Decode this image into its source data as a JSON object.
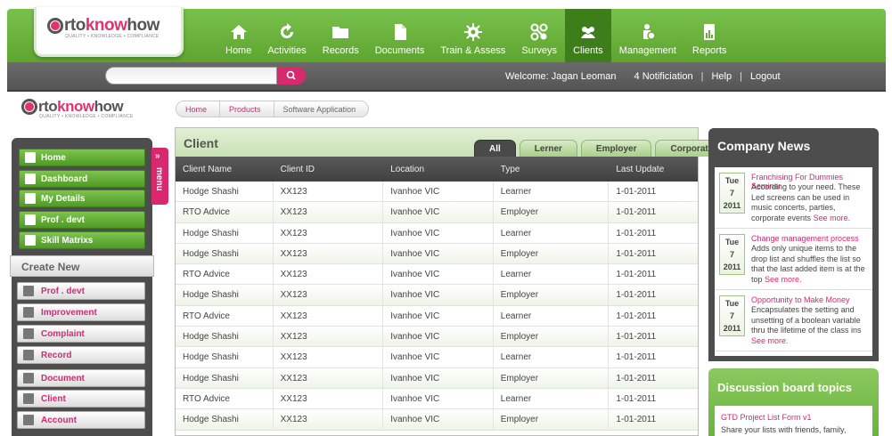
{
  "brand": {
    "part1": "rto",
    "part2": "know",
    "part3": "how",
    "tagline": "QUALITY • KNOWLEDGE • COMPLIANCE"
  },
  "nav": [
    {
      "label": "Home",
      "icon": "home-icon"
    },
    {
      "label": "Activities",
      "icon": "refresh-icon"
    },
    {
      "label": "Records",
      "icon": "folder-icon"
    },
    {
      "label": "Documents",
      "icon": "document-icon"
    },
    {
      "label": "Train & Assess",
      "icon": "gear-icon"
    },
    {
      "label": "Surveys",
      "icon": "survey-icon"
    },
    {
      "label": "Clients",
      "icon": "users-icon",
      "active": true
    },
    {
      "label": "Management",
      "icon": "management-icon"
    },
    {
      "label": "Reports",
      "icon": "reports-icon"
    }
  ],
  "search": {
    "placeholder": "",
    "value": ""
  },
  "topright": {
    "welcome": "Welcome: Jagan Leoman",
    "notifications": "4 Notificiation",
    "help": "Help",
    "logout": "Logout"
  },
  "sidebar": {
    "items": [
      "Home",
      "Dashboard",
      "My Details",
      "Prof . devt",
      "Skill Matrixs"
    ],
    "create_new": "Create New",
    "create_items": [
      "Prof . devt",
      "Improvement",
      "Complaint",
      "Record",
      "Document",
      "Client",
      "Account"
    ],
    "menu_tab": "menu"
  },
  "breadcrumb": [
    "Home",
    "Products",
    "Software Application"
  ],
  "client": {
    "title": "Client",
    "tabs": [
      "All",
      "Lerner",
      "Employer",
      "Corporate"
    ],
    "columns": [
      "Client Name",
      "Client ID",
      "Location",
      "Type",
      "Last Update"
    ],
    "rows": [
      [
        "Hodge Shashi",
        "XX123",
        "Ivanhoe VIC",
        "Learner",
        "1-01-2011"
      ],
      [
        "RTO Advice",
        "XX123",
        "Ivanhoe VIC",
        "Employer",
        "1-01-2011"
      ],
      [
        "Hodge Shashi",
        "XX123",
        "Ivanhoe VIC",
        "Learner",
        "1-01-2011"
      ],
      [
        "Hodge Shashi",
        "XX123",
        "Ivanhoe VIC",
        "Employer",
        "1-01-2011"
      ],
      [
        "RTO Advice",
        "XX123",
        "Ivanhoe VIC",
        "Learner",
        "1-01-2011"
      ],
      [
        "Hodge Shashi",
        "XX123",
        "Ivanhoe VIC",
        "Employer",
        "1-01-2011"
      ],
      [
        "RTO Advice",
        "XX123",
        "Ivanhoe VIC",
        "Learner",
        "1-01-2011"
      ],
      [
        "Hodge Shashi",
        "XX123",
        "Ivanhoe VIC",
        "Employer",
        "1-01-2011"
      ],
      [
        "Hodge Shashi",
        "XX123",
        "Ivanhoe VIC",
        "Learner",
        "1-01-2011"
      ],
      [
        "Hodge Shashi",
        "XX123",
        "Ivanhoe VIC",
        "Employer",
        "1-01-2011"
      ],
      [
        "RTO Advice",
        "XX123",
        "Ivanhoe VIC",
        "Learner",
        "1-01-2011"
      ],
      [
        "Hodge Shashi",
        "XX123",
        "Ivanhoe VIC",
        "Employer",
        "1-01-2011"
      ]
    ]
  },
  "news": {
    "title": "Company News",
    "items": [
      {
        "day": "Tue",
        "date": "7",
        "year": "2011",
        "title": "Franchising For Dummies Seminar",
        "text": "According to your need. These Led screens can be used in music concerts, parties, corporate events",
        "more": "See more."
      },
      {
        "day": "Tue",
        "date": "7",
        "year": "2011",
        "title": "Change management process",
        "text": "Adds only unique items to the drop list and shuffles the list so that the last added item is at the top",
        "more": "See more."
      },
      {
        "day": "Tue",
        "date": "7",
        "year": "2011",
        "title": "Opportunity to Make Money",
        "text": "Encapsulates the setting and unsetting of a boolean variable thru the lifetime of the class ins",
        "more": "See more."
      }
    ]
  },
  "discussion": {
    "title": "Discussion board topics",
    "item_title": "GTD Project List Form v1",
    "item_text": "Share your lists with friends, family,"
  }
}
